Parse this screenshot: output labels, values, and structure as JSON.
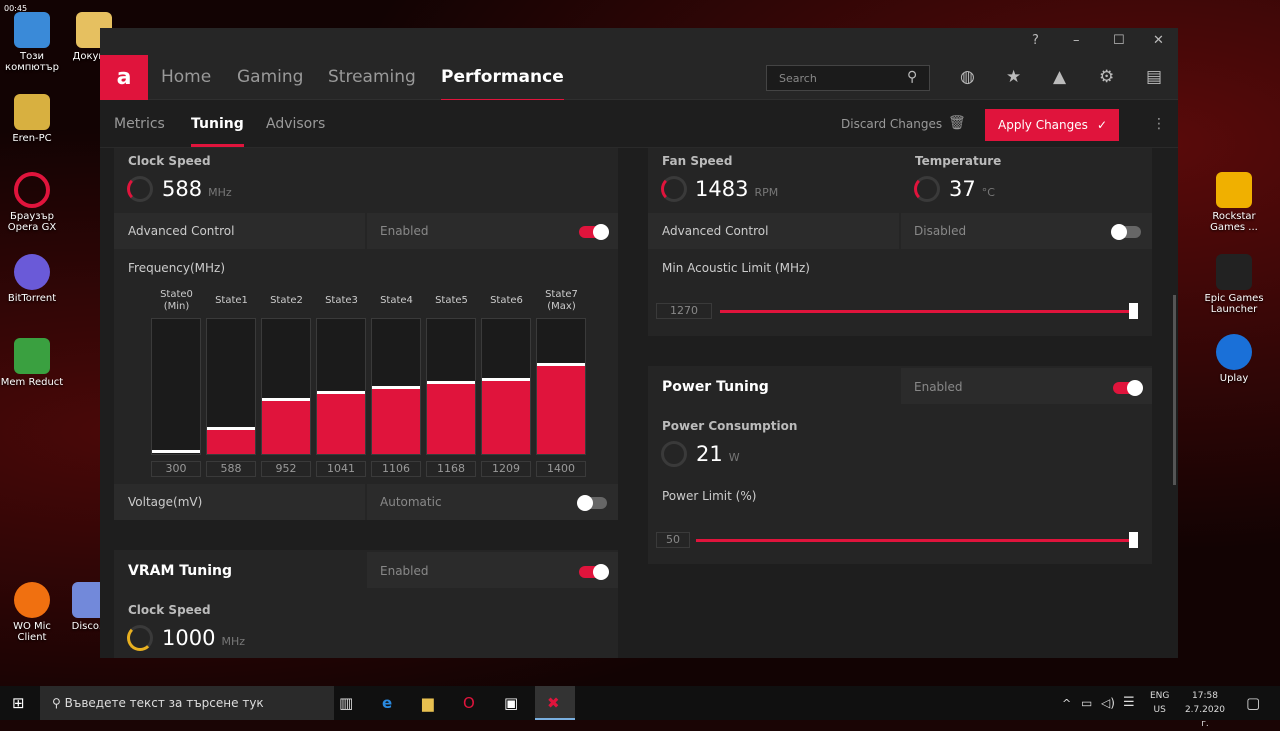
{
  "desktop": {
    "clock_corner": "00:45",
    "left_icons": [
      "Този компютър",
      "Докум...",
      "Eren-PC",
      "Браузър Opera GX",
      "BitTorrent",
      "Mem Reduct",
      "WO Mic Client",
      "Disco..."
    ],
    "right_icons": [
      "Rockstar Games ...",
      "Epic Games Launcher",
      "Uplay"
    ]
  },
  "window": {
    "help": "?",
    "minimize": "–",
    "maximize": "☐",
    "close": "✕"
  },
  "nav": {
    "logo": "a",
    "items": [
      "Home",
      "Gaming",
      "Streaming",
      "Performance"
    ],
    "active": 3,
    "search_placeholder": "Search"
  },
  "subnav": {
    "items": [
      "Metrics",
      "Tuning",
      "Advisors"
    ],
    "active": 1,
    "discard": "Discard Changes",
    "apply": "Apply Changes",
    "apply_icon": "✓"
  },
  "gpu": {
    "clock_label": "Clock Speed",
    "clock_value": "588",
    "clock_unit": "MHz",
    "adv_label": "Advanced Control",
    "adv_state": "Enabled",
    "adv_on": true,
    "freq_label": "Frequency(MHz)",
    "states": [
      {
        "name": "State0",
        "sub": "(Min)",
        "value": 300
      },
      {
        "name": "State1",
        "sub": "",
        "value": 588
      },
      {
        "name": "State2",
        "sub": "",
        "value": 952
      },
      {
        "name": "State3",
        "sub": "",
        "value": 1041
      },
      {
        "name": "State4",
        "sub": "",
        "value": 1106
      },
      {
        "name": "State5",
        "sub": "",
        "value": 1168
      },
      {
        "name": "State6",
        "sub": "",
        "value": 1209
      },
      {
        "name": "State7",
        "sub": "(Max)",
        "value": 1400
      }
    ],
    "voltage_label": "Voltage(mV)",
    "voltage_state": "Automatic",
    "voltage_on": false
  },
  "vram": {
    "title": "VRAM Tuning",
    "state": "Enabled",
    "on": true,
    "clock_label": "Clock Speed",
    "clock_value": "1000",
    "clock_unit": "MHz"
  },
  "fan": {
    "speed_label": "Fan Speed",
    "speed_value": "1483",
    "speed_unit": "RPM",
    "temp_label": "Temperature",
    "temp_value": "37",
    "temp_unit": "°C",
    "adv_label": "Advanced Control",
    "adv_state": "Disabled",
    "adv_on": false,
    "min_label": "Min Acoustic Limit (MHz)",
    "min_value": "1270"
  },
  "power": {
    "title": "Power Tuning",
    "state": "Enabled",
    "on": true,
    "cons_label": "Power Consumption",
    "cons_value": "21",
    "cons_unit": "W",
    "limit_label": "Power Limit (%)",
    "limit_value": "50"
  },
  "taskbar": {
    "search_placeholder": "Въведете текст за търсене тук",
    "lang1": "ENG",
    "lang2": "US",
    "time": "17:58",
    "date": "2.7.2020 г."
  },
  "colors": {
    "accent": "#e0143c",
    "panel": "#252525"
  }
}
